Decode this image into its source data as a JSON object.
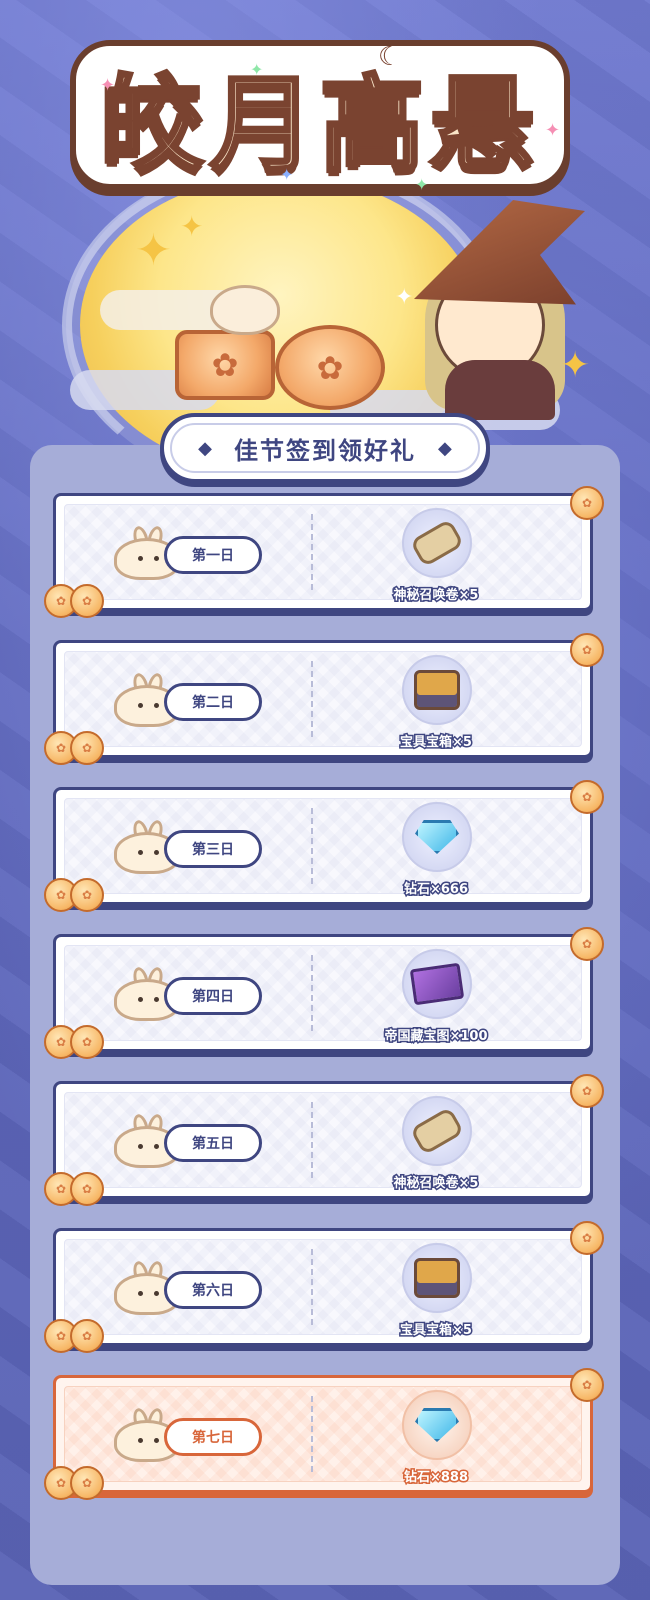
{
  "banner": {
    "title": "皎月高悬"
  },
  "panel": {
    "title": "佳节签到领好礼",
    "title_decoration": "◆"
  },
  "days": [
    {
      "label": "第一日",
      "reward": "神秘召唤卷×5",
      "icon": "scroll-icon"
    },
    {
      "label": "第二日",
      "reward": "宝具宝箱×5",
      "icon": "chest-icon"
    },
    {
      "label": "第三日",
      "reward": "钻石×666",
      "icon": "diamond-icon"
    },
    {
      "label": "第四日",
      "reward": "帝国藏宝图×100",
      "icon": "map-icon"
    },
    {
      "label": "第五日",
      "reward": "神秘召唤卷×5",
      "icon": "scroll-icon"
    },
    {
      "label": "第六日",
      "reward": "宝具宝箱×5",
      "icon": "chest-icon"
    },
    {
      "label": "第七日",
      "reward": "钻石×888",
      "icon": "diamond-icon",
      "highlight": true
    }
  ],
  "colors": {
    "background": "#5a63b5",
    "panel": "#a6add8",
    "outline": "#3f4681",
    "highlight": "#d8663a"
  }
}
